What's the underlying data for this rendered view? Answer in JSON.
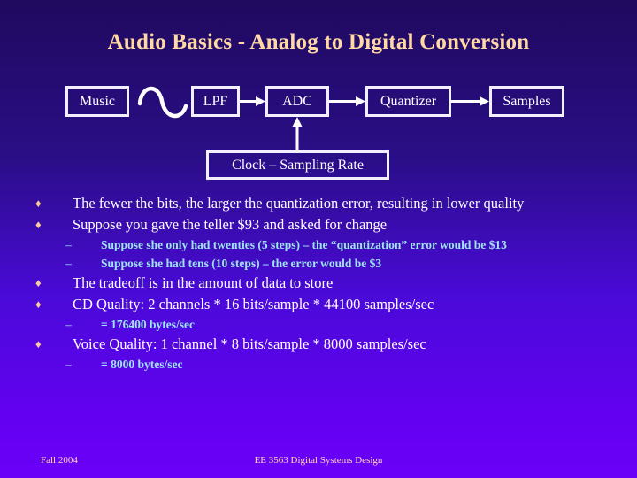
{
  "slide": {
    "title": "Audio Basics - Analog to Digital Conversion",
    "background_top_color": "#1f0a5e",
    "background_bottom_color": "#6b00f8",
    "title_color": "#ffd8a3",
    "bullet_color": "#ffcb9a",
    "subbullet_color": "#9fe4f2",
    "box_border_color": "#f2f0ff"
  },
  "diagram": {
    "boxes": [
      {
        "id": "music",
        "label": "Music"
      },
      {
        "id": "lpf",
        "label": "LPF"
      },
      {
        "id": "adc",
        "label": "ADC"
      },
      {
        "id": "quantizer",
        "label": "Quantizer"
      },
      {
        "id": "samples",
        "label": "Samples"
      },
      {
        "id": "clock",
        "label": "Clock – Sampling Rate"
      }
    ],
    "waveform": "sine-wave",
    "connections": [
      {
        "from": "lpf",
        "to": "adc",
        "direction": "right"
      },
      {
        "from": "adc",
        "to": "quantizer",
        "direction": "right"
      },
      {
        "from": "quantizer",
        "to": "samples",
        "direction": "right"
      },
      {
        "from": "clock",
        "to": "adc",
        "direction": "up"
      }
    ]
  },
  "content": {
    "bullets": [
      {
        "level": 1,
        "marker": "♦",
        "text": "The fewer the bits, the larger the quantization error, resulting in lower quality"
      },
      {
        "level": 1,
        "marker": "♦",
        "text": "Suppose you gave the teller $93 and asked for change"
      },
      {
        "level": 2,
        "marker": "–",
        "text": "Suppose she only had twenties (5 steps) – the “quantization” error would be $13"
      },
      {
        "level": 2,
        "marker": "–",
        "text": "Suppose she had tens (10 steps) – the error would be $3"
      },
      {
        "level": 1,
        "marker": "♦",
        "text": "The tradeoff is in the amount of data to store"
      },
      {
        "level": 1,
        "marker": "♦",
        "text": "CD Quality:  2 channels * 16 bits/sample * 44100 samples/sec"
      },
      {
        "level": 2,
        "marker": "–",
        "text": "= 176400 bytes/sec"
      },
      {
        "level": 1,
        "marker": "♦",
        "text": "Voice Quality: 1 channel * 8 bits/sample * 8000 samples/sec"
      },
      {
        "level": 2,
        "marker": "–",
        "text": "= 8000 bytes/sec"
      }
    ]
  },
  "footer": {
    "left": "Fall 2004",
    "center": "EE 3563 Digital Systems Design"
  }
}
